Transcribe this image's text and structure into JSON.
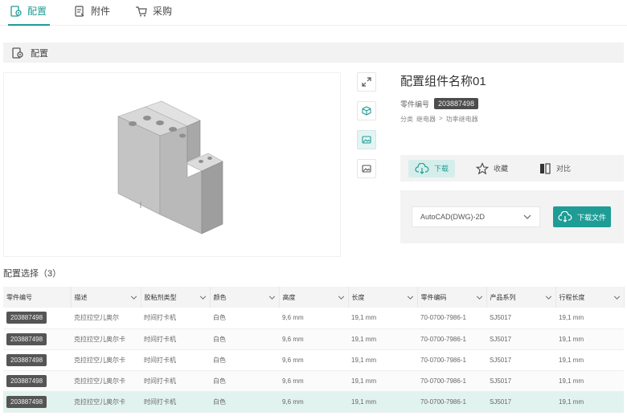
{
  "tabs": [
    {
      "label": "配置",
      "icon": "config-icon",
      "active": true
    },
    {
      "label": "附件",
      "icon": "attachment-icon",
      "active": false
    },
    {
      "label": "采购",
      "icon": "cart-icon",
      "active": false
    }
  ],
  "section": {
    "label": "配置"
  },
  "info": {
    "title": "配置组件名称01",
    "part_no_label": "零件编号",
    "part_no": "203887498",
    "category_label": "分类",
    "category_l1": "继电器",
    "category_sep": ">",
    "category_l2": "功率继电器"
  },
  "actions": {
    "download": "下载",
    "favorite": "收藏",
    "compare": "对比"
  },
  "download_box": {
    "format": "AutoCAD(DWG)-2D",
    "button": "下载文件"
  },
  "table": {
    "title": "配置选择（3）",
    "columns": [
      "零件编号",
      "描述",
      "胶粘剂类型",
      "颜色",
      "高度",
      "长度",
      "零件编码",
      "产品系列",
      "行程长度"
    ],
    "rows": [
      [
        "203887498",
        "克拉拉空儿奥尔",
        "时间打卡机",
        "白色",
        "9,6 mm",
        "19,1 mm",
        "70-0700-7986-1",
        "SJ5017",
        "19,1 mm"
      ],
      [
        "203887498",
        "克拉拉空儿奥尔卡",
        "时间打卡机",
        "白色",
        "9,6 mm",
        "19,1 mm",
        "70-0700-7986-1",
        "SJ5017",
        "19,1 mm"
      ],
      [
        "203887498",
        "克拉拉空儿奥尔卡",
        "时间打卡机",
        "白色",
        "9,6 mm",
        "19,1 mm",
        "70-0700-7986-1",
        "SJ5017",
        "19,1 mm"
      ],
      [
        "203887498",
        "克拉拉空儿奥尔卡",
        "时间打卡机",
        "白色",
        "9,6 mm",
        "19,1 mm",
        "70-0700-7986-1",
        "SJ5017",
        "19,1 mm"
      ],
      [
        "203887498",
        "克拉拉空儿奥尔卡",
        "时间打卡机",
        "白色",
        "9,6 mm",
        "19,1 mm",
        "70-0700-7986-1",
        "SJ5017",
        "19,1 mm"
      ]
    ]
  },
  "colors": {
    "accent": "#1f9c96",
    "selected_row": "#e1f3ef"
  }
}
